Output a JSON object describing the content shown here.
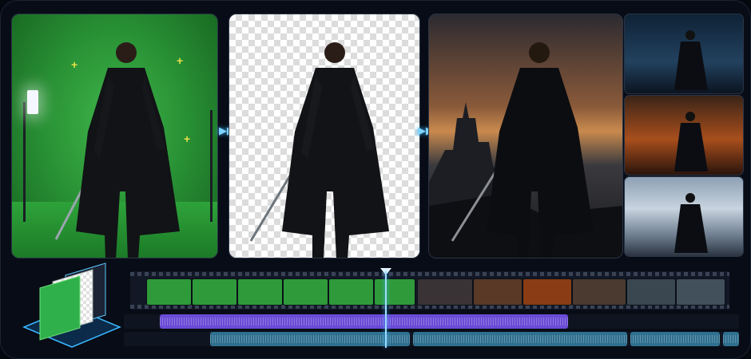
{
  "panels": [
    {
      "id": "green-screen",
      "background": "#2a9436"
    },
    {
      "id": "transparent-cutout",
      "background": "#ffffff"
    },
    {
      "id": "fantasy-composite",
      "background": "#8a5a3a"
    }
  ],
  "thumbnails": [
    {
      "id": "night-city",
      "color": "#22415e"
    },
    {
      "id": "burning-harbor",
      "color": "#a84e1c"
    },
    {
      "id": "snowy-mountains",
      "color": "#c8d4df"
    }
  ],
  "timeline": {
    "video_clips_green": 6,
    "video_clips_dark": 7,
    "audio_track_1_color": "#6a4bd6",
    "audio_track_2_color": "#2f6f8f",
    "playhead_color": "#9fdcff"
  },
  "icons": {
    "arrow_1": "double-chevron-right-icon",
    "arrow_2": "double-chevron-right-icon",
    "layers": "layers-icon"
  },
  "accent": "#3ab8ff"
}
